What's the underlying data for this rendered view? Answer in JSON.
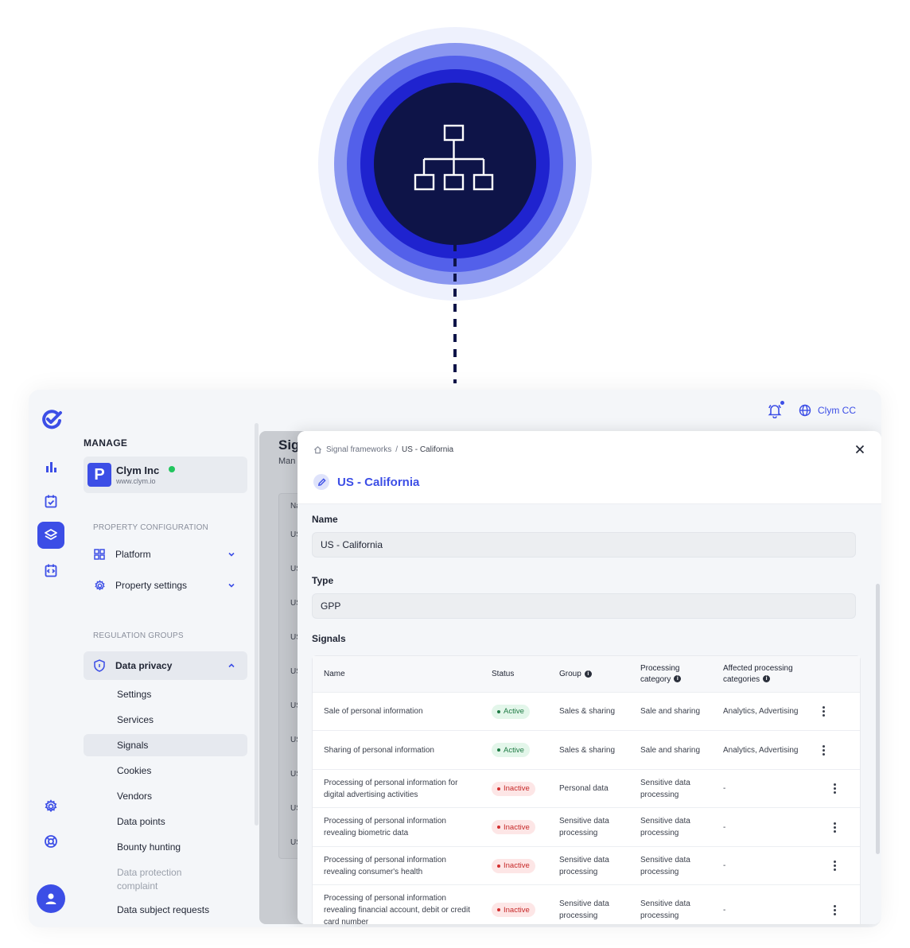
{
  "topbar": {
    "account_label": "Clym CC"
  },
  "nav": {
    "manage_label": "MANAGE",
    "org": {
      "name": "Clym Inc",
      "url": "www.clym.io",
      "initial": "P"
    },
    "property_config_label": "PROPERTY CONFIGURATION",
    "platform_label": "Platform",
    "property_settings_label": "Property settings",
    "regulation_groups_label": "REGULATION GROUPS",
    "data_privacy_label": "Data privacy",
    "sub_items": [
      "Settings",
      "Services",
      "Signals",
      "Cookies",
      "Vendors",
      "Data points",
      "Bounty hunting",
      "Data protection complaint",
      "Data subject requests"
    ]
  },
  "under": {
    "title": "Sig",
    "subtitle": "Man",
    "header": "Na",
    "row_label": "US"
  },
  "modal": {
    "breadcrumb_root": "Signal frameworks",
    "breadcrumb_sep": "/",
    "breadcrumb_current": "US - California",
    "title": "US - California",
    "name_label": "Name",
    "name_value": "US - California",
    "type_label": "Type",
    "type_value": "GPP",
    "signals_label": "Signals",
    "table": {
      "headers": {
        "name": "Name",
        "status": "Status",
        "group": "Group",
        "processing_1": "Processing",
        "processing_2": "category",
        "affected_1": "Affected processing",
        "affected_2": "categories"
      },
      "rows": [
        {
          "name": "Sale of personal information",
          "status": "Active",
          "group": "Sales & sharing",
          "processing": "Sale and sharing",
          "affected": "Analytics, Advertising"
        },
        {
          "name": "Sharing of personal information",
          "status": "Active",
          "group": "Sales & sharing",
          "processing": "Sale and sharing",
          "affected": "Analytics, Advertising"
        },
        {
          "name": "Processing of personal information for digital advertising activities",
          "status": "Inactive",
          "group": "Personal data",
          "processing": "Sensitive data processing",
          "affected": "-"
        },
        {
          "name": "Processing of personal information revealing biometric data",
          "status": "Inactive",
          "group": "Sensitive data processing",
          "processing": "Sensitive data processing",
          "affected": "-"
        },
        {
          "name": "Processing of personal information revealing consumer's health",
          "status": "Inactive",
          "group": "Sensitive data processing",
          "processing": "Sensitive data processing",
          "affected": "-"
        },
        {
          "name": "Processing of personal information revealing financial account, debit or credit card number",
          "status": "Inactive",
          "group": "Sensitive data processing",
          "processing": "Sensitive data processing",
          "affected": "-"
        }
      ]
    }
  },
  "colors": {
    "accent": "#3c4ee6",
    "ring_core": "#0e1448",
    "active": "#1e7a44",
    "inactive": "#d32f2f"
  }
}
